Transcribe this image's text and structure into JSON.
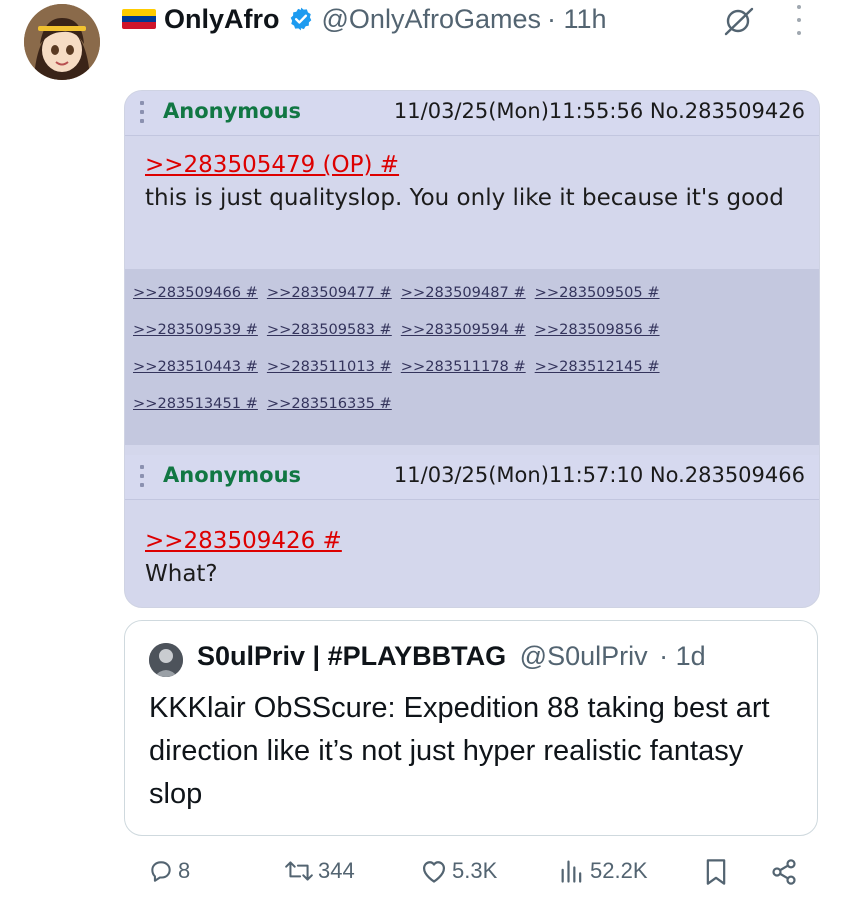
{
  "author": {
    "display_name": "OnlyAfro",
    "handle": "@OnlyAfroGames",
    "time": "· 11h",
    "flag_colors": [
      "#ffcc00",
      "#003893",
      "#cf142b"
    ]
  },
  "header_icons": {
    "grok": "grok-icon",
    "more": "more-icon"
  },
  "image_post": {
    "op": {
      "name": "Anonymous",
      "meta": "11/03/25(Mon)11:55:56 No.283509426",
      "quote_link": ">>283505479 (OP) #",
      "text": "this is just qualityslop. You only like it because it's good"
    },
    "replies": [
      [
        ">>283509466 #",
        ">>283509477 #",
        ">>283509487 #",
        ">>283509505 #"
      ],
      [
        ">>283509539 #",
        ">>283509583 #",
        ">>283509594 #",
        ">>283509856 #"
      ],
      [
        ">>283510443 #",
        ">>283511013 #",
        ">>283511178 #",
        ">>283512145 #"
      ],
      [
        ">>283513451 #",
        ">>283516335 #"
      ]
    ],
    "reply_post": {
      "name": "Anonymous",
      "meta": "11/03/25(Mon)11:57:10 No.283509466",
      "quote_link": ">>283509426 #",
      "text": "What?"
    },
    "colors": {
      "name": "#117743",
      "quote_link": "#dd0000",
      "reply_link": "#34345c",
      "background": "#d6daf0"
    }
  },
  "quoted_tweet": {
    "display_name": "S0ulPriv | #PLAYBBTAG",
    "handle": "@S0ulPriv",
    "time": "· 1d",
    "text": "KKKlair ObSScure: Expedition 88 taking best art direction like it’s not just hyper realistic fantasy slop"
  },
  "actions": {
    "replies": "8",
    "reposts": "344",
    "likes": "5.3K",
    "views": "52.2K"
  },
  "accent_color": "#1d9bf0"
}
